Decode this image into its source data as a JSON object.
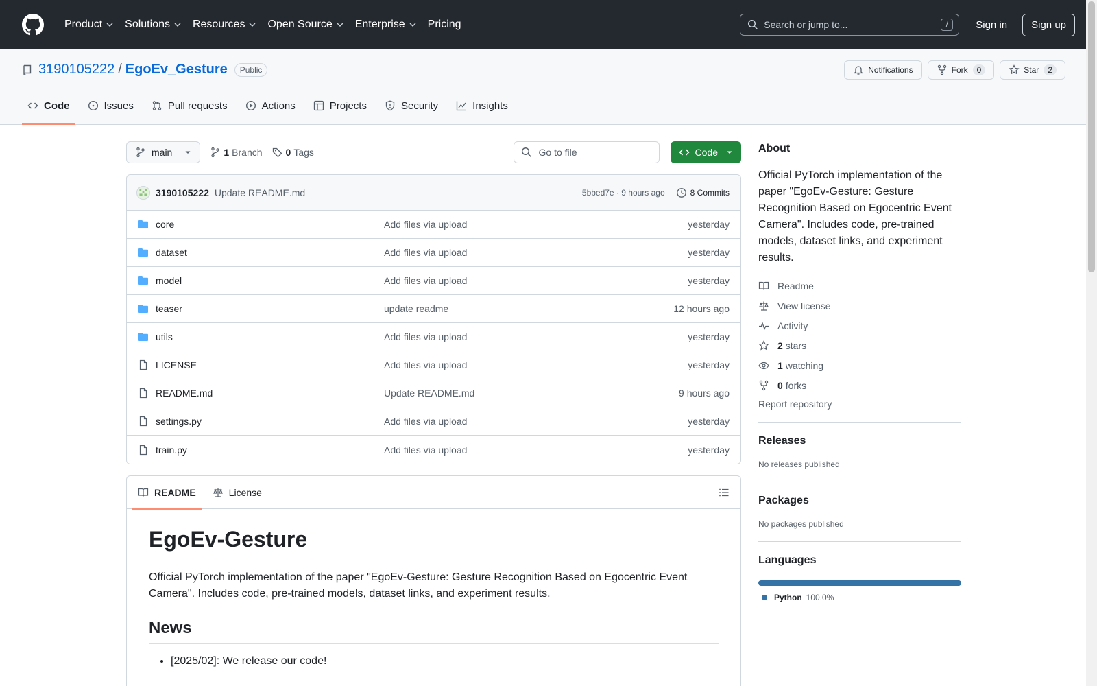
{
  "topnav": {
    "items": [
      "Product",
      "Solutions",
      "Resources",
      "Open Source",
      "Enterprise",
      "Pricing"
    ],
    "search_placeholder": "Search or jump to...",
    "search_key": "/",
    "signin": "Sign in",
    "signup": "Sign up"
  },
  "repo": {
    "owner": "3190105222",
    "separator": "/",
    "name": "EgoEv_Gesture",
    "visibility": "Public",
    "notifications_label": "Notifications",
    "fork_label": "Fork",
    "fork_count": "0",
    "star_label": "Star",
    "star_count": "2"
  },
  "tabs": [
    "Code",
    "Issues",
    "Pull requests",
    "Actions",
    "Projects",
    "Security",
    "Insights"
  ],
  "toolbar": {
    "branch": "main",
    "branch_count": "1",
    "branch_label": "Branch",
    "tag_count": "0",
    "tag_label": "Tags",
    "goto_placeholder": "Go to file",
    "code_button": "Code"
  },
  "commit": {
    "author": "3190105222",
    "message": "Update README.md",
    "meta": "5bbed7e · 9 hours ago",
    "commits_label": "8 Commits"
  },
  "files": [
    {
      "name": "core",
      "type": "folder",
      "message": "Add files via upload",
      "time": "yesterday"
    },
    {
      "name": "dataset",
      "type": "folder",
      "message": "Add files via upload",
      "time": "yesterday"
    },
    {
      "name": "model",
      "type": "folder",
      "message": "Add files via upload",
      "time": "yesterday"
    },
    {
      "name": "teaser",
      "type": "folder",
      "message": "update readme",
      "time": "12 hours ago"
    },
    {
      "name": "utils",
      "type": "folder",
      "message": "Add files via upload",
      "time": "yesterday"
    },
    {
      "name": "LICENSE",
      "type": "file",
      "message": "Add files via upload",
      "time": "yesterday"
    },
    {
      "name": "README.md",
      "type": "file",
      "message": "Update README.md",
      "time": "9 hours ago"
    },
    {
      "name": "settings.py",
      "type": "file",
      "message": "Add files via upload",
      "time": "yesterday"
    },
    {
      "name": "train.py",
      "type": "file",
      "message": "Add files via upload",
      "time": "yesterday"
    }
  ],
  "readme": {
    "tab_readme": "README",
    "tab_license": "License",
    "title": "EgoEv-Gesture",
    "intro": "Official PyTorch implementation of the paper \"EgoEv-Gesture: Gesture Recognition Based on Egocentric Event Camera\". Includes code, pre-trained models, dataset links, and experiment results.",
    "news_heading": "News",
    "news_item": "[2025/02]: We release our code!"
  },
  "about": {
    "heading": "About",
    "description": "Official PyTorch implementation of the paper \"EgoEv-Gesture: Gesture Recognition Based on Egocentric Event Camera\". Includes code, pre-trained models, dataset links, and experiment results.",
    "readme": "Readme",
    "license": "View license",
    "activity": "Activity",
    "stars_count": "2",
    "stars_label": "stars",
    "watching_count": "1",
    "watching_label": "watching",
    "forks_count": "0",
    "forks_label": "forks",
    "report": "Report repository"
  },
  "releases": {
    "heading": "Releases",
    "text": "No releases published"
  },
  "packages": {
    "heading": "Packages",
    "text": "No packages published"
  },
  "languages": {
    "heading": "Languages",
    "name": "Python",
    "percent": "100.0%",
    "color": "#3572A5",
    "share": 1.0
  },
  "colors": {
    "header_bg": "#24292f",
    "link": "#0969da",
    "code_button": "#1f883d",
    "active_tab_underline": "#fd8c73"
  }
}
